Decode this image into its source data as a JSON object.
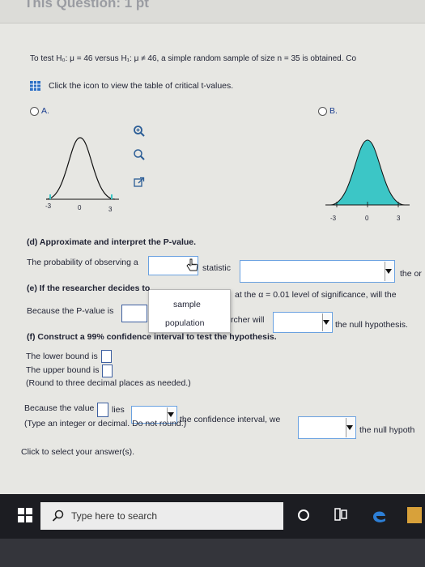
{
  "header": {
    "title": "This Question: 1 pt"
  },
  "question": {
    "intro": "To test H₀: μ = 46 versus H₁: μ ≠ 46, a simple random sample of size n = 35 is obtained. Co",
    "table_link": "Click the icon to view the table of critical t-values.",
    "option_a": "A.",
    "option_b": "B.",
    "axis_a": [
      "-3",
      "0",
      "3"
    ],
    "axis_b": [
      "-3",
      "0",
      "3"
    ]
  },
  "part_d": {
    "heading": "(d) Approximate and interpret the P-value.",
    "sentence_start": "The probability of observing a",
    "statistic_label": "statistic",
    "trailing": "the or",
    "dropdown_options": [
      "sample",
      "population"
    ]
  },
  "part_e": {
    "heading": "(e) If the researcher decides to",
    "level_text": "at the α = 0.01 level of significance, will the",
    "because": "Because the P-value is",
    "researcher_will": "rcher will",
    "null_hyp": "the null hypothesis."
  },
  "part_f": {
    "heading": "(f) Construct a 99% confidence interval to test the hypothesis.",
    "lower": "The lower bound is",
    "upper": "The upper bound is",
    "round_note": "(Round to three decimal places as needed.)",
    "because_value": "Because the value",
    "lies": "lies",
    "ci_text": "the confidence interval, we",
    "null_hyp2": "the null hypoth",
    "type_note": "(Type an integer or decimal. Do not round.)"
  },
  "footer": {
    "select_text": "Click to select your answer(s)."
  },
  "taskbar": {
    "search_placeholder": "Type here to search"
  },
  "colors": {
    "curve_fill": "#3cc6c6",
    "accent_blue": "#1a3d8f",
    "box_border": "#6aa1e0"
  },
  "icons": [
    "zoom-in-icon",
    "zoom-out-icon",
    "popout-icon",
    "table-icon",
    "windows-start-icon",
    "search-icon",
    "cortana-icon",
    "task-view-icon",
    "edge-icon"
  ]
}
